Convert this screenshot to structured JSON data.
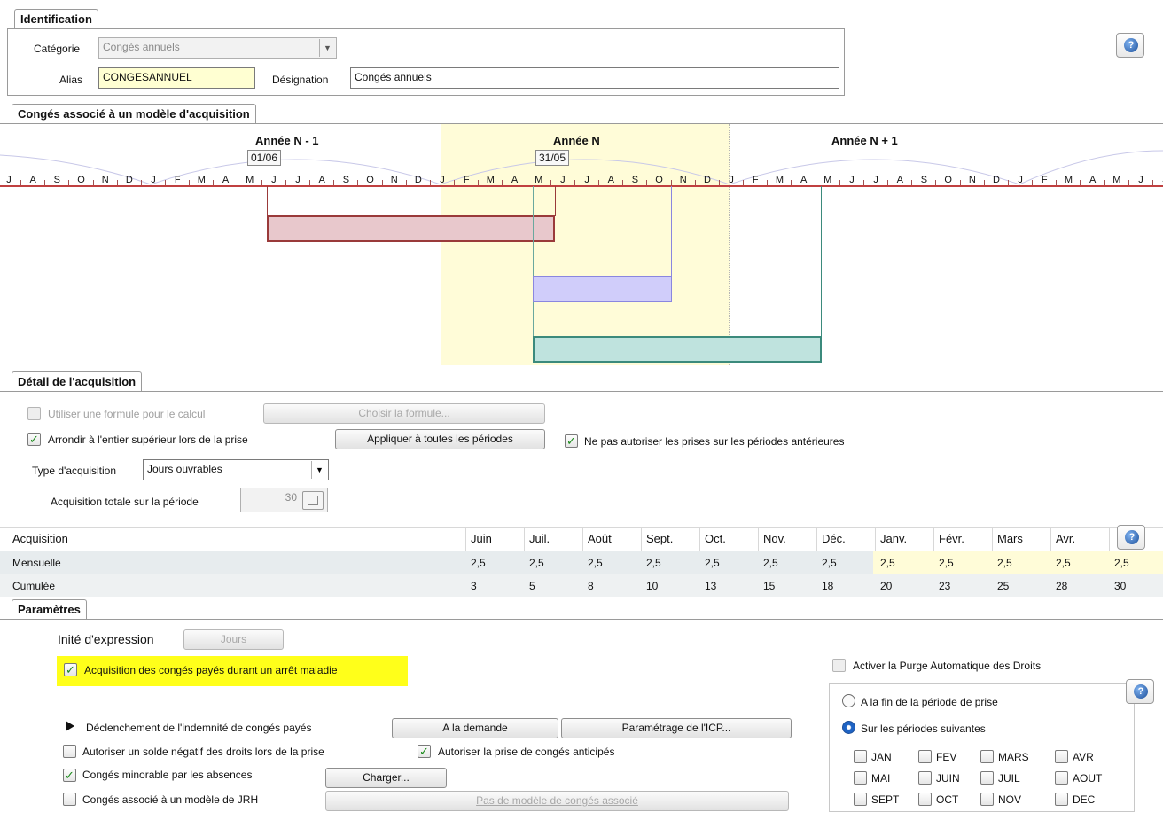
{
  "identification": {
    "tab_label": "Identification",
    "categorie_label": "Catégorie",
    "categorie_value": "Congés annuels",
    "alias_label": "Alias",
    "alias_value": "CONGESANNUEL",
    "designation_label": "Désignation",
    "designation_value": "Congés annuels"
  },
  "help_icon_glyph": "?",
  "timeline": {
    "tab_label": "Congés associé à un modèle d'acquisition",
    "years": [
      "Année N - 1",
      "Année N",
      "Année N + 1"
    ],
    "marker_start": "01/06",
    "marker_end": "31/05",
    "months": [
      "J",
      "A",
      "S",
      "O",
      "N",
      "D",
      "J",
      "F",
      "M",
      "A",
      "M",
      "J",
      "J",
      "A",
      "S",
      "O",
      "N",
      "D",
      "J",
      "F",
      "M",
      "A",
      "M",
      "J",
      "J",
      "A",
      "S",
      "O",
      "N",
      "D",
      "J",
      "F",
      "M",
      "A",
      "M",
      "J",
      "J",
      "A",
      "S",
      "O",
      "N",
      "D",
      "J",
      "F",
      "M",
      "A",
      "M",
      "J",
      "J"
    ]
  },
  "detail": {
    "tab_label": "Détail de l'acquisition",
    "formula_checkbox_label": "Utiliser une formule pour le calcul",
    "formula_button": "Choisir la formule...",
    "round_checkbox_label": "Arrondir à l'entier supérieur lors de la prise",
    "apply_all_button": "Appliquer à toutes les périodes",
    "no_prior_checkbox_label": "Ne pas autoriser les prises sur les périodes antérieures",
    "type_label": "Type d'acquisition",
    "type_value": "Jours ouvrables",
    "total_label": "Acquisition totale sur la période",
    "total_value": "30"
  },
  "acquisition_table": {
    "header_label": "Acquisition",
    "months": [
      "Juin",
      "Juil.",
      "Août",
      "Sept.",
      "Oct.",
      "Nov.",
      "Déc.",
      "Janv.",
      "Févr.",
      "Mars",
      "Avr."
    ],
    "rows": [
      {
        "label": "Mensuelle",
        "values": [
          "2,5",
          "2,5",
          "2,5",
          "2,5",
          "2,5",
          "2,5",
          "2,5",
          "2,5",
          "2,5",
          "2,5",
          "2,5",
          "2,5"
        ]
      },
      {
        "label": "Cumulée",
        "values": [
          "3",
          "5",
          "8",
          "10",
          "13",
          "15",
          "18",
          "20",
          "23",
          "25",
          "28",
          "30"
        ]
      }
    ]
  },
  "parametres": {
    "tab_label": "Paramètres",
    "unite_label": "Inité d'expression",
    "unite_button": "Jours",
    "maladie_checkbox_label": "Acquisition des congés payés durant un arrêt maladie",
    "declenchement_label": "Déclenchement de l'indemnité de congés payés",
    "demande_button": "A la demande",
    "icp_button": "Paramétrage de l'ICP...",
    "solde_checkbox_label": "Autoriser un solde négatif des droits lors de la prise",
    "anticipes_checkbox_label": "Autoriser la prise de congés anticipés",
    "minorable_checkbox_label": "Congés minorable par les absences",
    "charger_button": "Charger...",
    "jrh_checkbox_label": "Congés associé à un modèle de JRH",
    "jrh_button": "Pas de modèle de congés associé",
    "purge_checkbox_label": "Activer la Purge Automatique des Droits",
    "radio_fin_label": "A la fin de la période de prise",
    "radio_suivantes_label": "Sur les périodes suivantes",
    "months": [
      "JAN",
      "FEV",
      "MARS",
      "AVR",
      "MAI",
      "JUIN",
      "JUIL",
      "AOUT",
      "SEPT",
      "OCT",
      "NOV",
      "DEC"
    ]
  },
  "colors": {
    "year_n_band": "#fffcd8",
    "bar_red": "#e8c8cc",
    "bar_red_border": "#9a3a3a",
    "bar_purple": "#d0cdfa",
    "bar_purple_border": "#8a86e0",
    "bar_teal": "#bfe3de",
    "bar_teal_border": "#3b8a7c",
    "highlight_yellow": "#ffff1a"
  }
}
